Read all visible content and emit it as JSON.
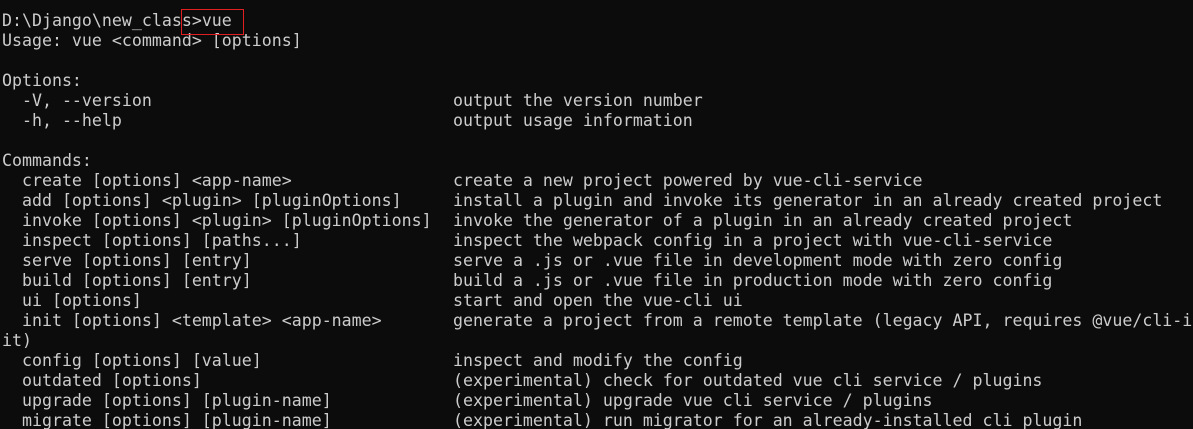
{
  "prompt": {
    "path": "D:\\Django\\new_class>",
    "command": "vue"
  },
  "usage": "Usage: vue <command> [options]",
  "options_header": "Options:",
  "options": [
    {
      "flag": "  -V, --version",
      "description": "output the version number"
    },
    {
      "flag": "  -h, --help",
      "description": "output usage information"
    }
  ],
  "commands_header": "Commands:",
  "commands": [
    {
      "name": "  create [options] <app-name>",
      "description": "create a new project powered by vue-cli-service"
    },
    {
      "name": "  add [options] <plugin> [pluginOptions]",
      "description": "install a plugin and invoke its generator in an already created project"
    },
    {
      "name": "  invoke [options] <plugin> [pluginOptions]",
      "description": "invoke the generator of a plugin in an already created project"
    },
    {
      "name": "  inspect [options] [paths...]",
      "description": "inspect the webpack config in a project with vue-cli-service"
    },
    {
      "name": "  serve [options] [entry]",
      "description": "serve a .js or .vue file in development mode with zero config"
    },
    {
      "name": "  build [options] [entry]",
      "description": "build a .js or .vue file in production mode with zero config"
    },
    {
      "name": "  ui [options]",
      "description": "start and open the vue-cli ui"
    },
    {
      "name": "  init [options] <template> <app-name>",
      "description": "generate a project from a remote template (legacy API, requires @vue/cli-in"
    }
  ],
  "wrap_continuation": "it)",
  "commands_more": [
    {
      "name": "  config [options] [value]",
      "description": "inspect and modify the config"
    },
    {
      "name": "  outdated [options]",
      "description": "(experimental) check for outdated vue cli service / plugins"
    },
    {
      "name": "  upgrade [options] [plugin-name]",
      "description": "(experimental) upgrade vue cli service / plugins"
    },
    {
      "name": "  migrate [options] [plugin-name]",
      "description": "(experimental) run migrator for an already-installed cli plugin"
    }
  ],
  "colors": {
    "background": "#0c0c0c",
    "text": "#cccccc",
    "highlight_border": "#e02020"
  }
}
